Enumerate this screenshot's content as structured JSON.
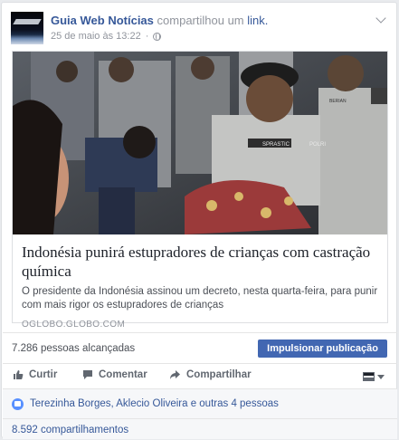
{
  "post": {
    "page_name": "Guia Web Notícias",
    "action_text": "compartilhou um",
    "link_word": "link.",
    "timestamp": "25 de maio às 13:22",
    "privacy_icon": "globe-icon",
    "menu_icon": "chevron-down-icon"
  },
  "attachment": {
    "title": "Indonésia punirá estupradores de crianças com castração química",
    "description": "O presidente da Indonésia assinou um decreto, nesta quarta-feira, para punir com mais rigor os estupradores de crianças",
    "domain": "OGLOBO.GLOBO.COM",
    "photo_labels": [
      "SPRASTIC",
      "POLRI",
      "BERIAN"
    ]
  },
  "insights": {
    "reach": "7.286 pessoas alcançadas",
    "boost_label": "Impulsionar publicação"
  },
  "actions": {
    "like": "Curtir",
    "comment": "Comentar",
    "share": "Compartilhar"
  },
  "social": {
    "likers": "Terezinha Borges, Aklecio Oliveira e outras 4 pessoas",
    "shares": "8.592 compartilhamentos"
  },
  "colors": {
    "link_blue": "#365899",
    "button_blue": "#4267b2",
    "muted": "#90949c"
  }
}
